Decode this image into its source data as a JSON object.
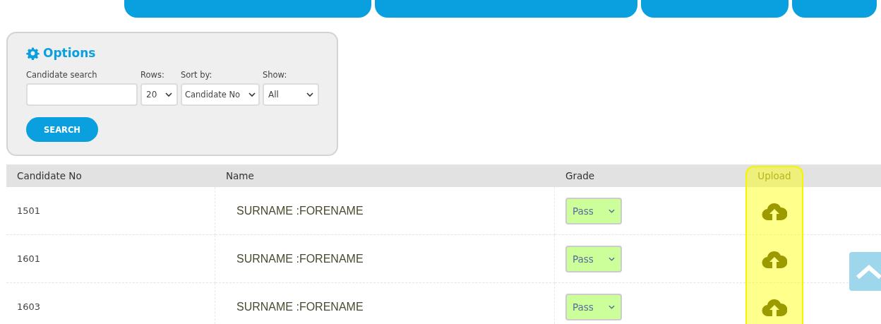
{
  "nav_buttons": [
    {
      "kind": "nav"
    },
    {
      "kind": "nav"
    },
    {
      "kind": "nav"
    },
    {
      "kind": "nav"
    }
  ],
  "options": {
    "title": "Options",
    "search_label": "Candidate search",
    "rows_label": "Rows:",
    "rows_value": "20",
    "sort_label": "Sort by:",
    "sort_value": "Candidate No",
    "show_label": "Show:",
    "show_value": "All",
    "search_button": "SEARCH"
  },
  "table": {
    "columns": [
      "Candidate No",
      "Name",
      "Grade",
      "Upload"
    ],
    "upload_highlighted": true,
    "rows": [
      {
        "candidate_no": "1501",
        "name": "SURNAME :FORENAME",
        "grade": "Pass"
      },
      {
        "candidate_no": "1601",
        "name": "SURNAME :FORENAME",
        "grade": "Pass"
      },
      {
        "candidate_no": "1603",
        "name": "SURNAME :FORENAME",
        "grade": "Pass"
      }
    ]
  },
  "scroll_top_button": true
}
